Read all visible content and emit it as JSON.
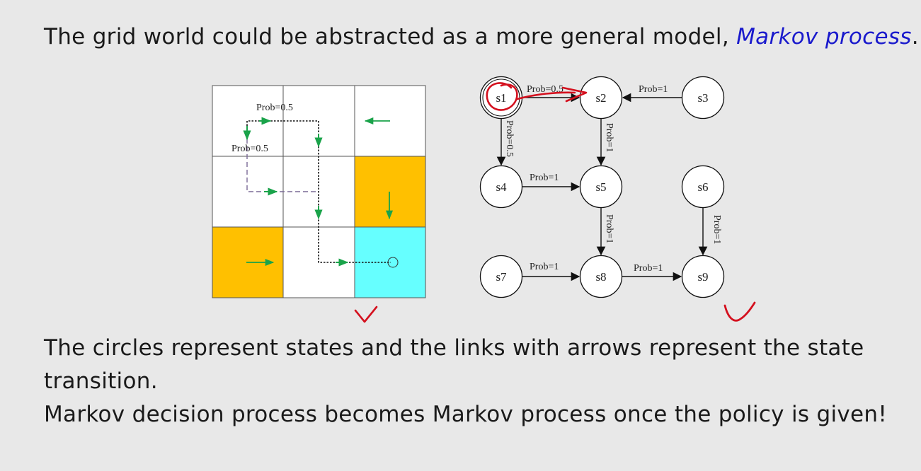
{
  "headline": {
    "text_before": "The grid world could be abstracted as a more general model, ",
    "accent_text": "Markov process",
    "text_after": "."
  },
  "description": {
    "line1": "The circles represent states and the links with arrows represent the state",
    "line2": "transition.",
    "line3": "Markov decision process becomes Markov process once the policy is given!"
  },
  "grid_world": {
    "rows": 3,
    "cols": 3,
    "cell_colors": [
      [
        "#ffffff",
        "#ffffff",
        "#ffffff"
      ],
      [
        "#ffffff",
        "#ffffff",
        "#ffc000"
      ],
      [
        "#ffc000",
        "#ffffff",
        "#66ffff"
      ]
    ],
    "policy_arrows": [
      {
        "row": 0,
        "col": 2,
        "dir": "left"
      },
      {
        "row": 1,
        "col": 2,
        "dir": "down"
      },
      {
        "row": 2,
        "col": 0,
        "dir": "right"
      }
    ],
    "labels": {
      "top_path": "Prob=0.5",
      "left_path": "Prob=0.5"
    },
    "arrow_color": "#1aa34a"
  },
  "markov_graph": {
    "states": [
      "s1",
      "s2",
      "s3",
      "s4",
      "s5",
      "s6",
      "s7",
      "s8",
      "s9"
    ],
    "transitions": [
      {
        "from": "s1",
        "to": "s2",
        "label": "Prob=0.5"
      },
      {
        "from": "s1",
        "to": "s4",
        "label": "Prob=0.5"
      },
      {
        "from": "s3",
        "to": "s2",
        "label": "Prob=1"
      },
      {
        "from": "s2",
        "to": "s5",
        "label": "Prob=1"
      },
      {
        "from": "s4",
        "to": "s5",
        "label": "Prob=1"
      },
      {
        "from": "s5",
        "to": "s8",
        "label": "Prob=1"
      },
      {
        "from": "s6",
        "to": "s9",
        "label": "Prob=1"
      },
      {
        "from": "s7",
        "to": "s8",
        "label": "Prob=1"
      },
      {
        "from": "s8",
        "to": "s9",
        "label": "Prob=1"
      }
    ]
  },
  "annotation_color": "#d4101e"
}
